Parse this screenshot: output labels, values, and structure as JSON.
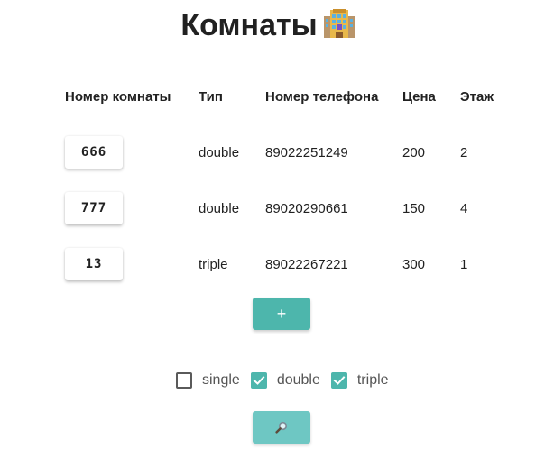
{
  "header": {
    "title": "Комнаты"
  },
  "table": {
    "columns": [
      "Номер комнаты",
      "Тип",
      "Номер телефона",
      "Цена",
      "Этаж"
    ],
    "rows": [
      {
        "room": "666",
        "type": "double",
        "phone": "89022251249",
        "price": "200",
        "floor": "2"
      },
      {
        "room": "777",
        "type": "double",
        "phone": "89020290661",
        "price": "150",
        "floor": "4"
      },
      {
        "room": "13",
        "type": "triple",
        "phone": "89022267221",
        "price": "300",
        "floor": "1"
      }
    ]
  },
  "actions": {
    "add_label": "+"
  },
  "filters": [
    {
      "label": "single",
      "checked": false
    },
    {
      "label": "double",
      "checked": true
    },
    {
      "label": "triple",
      "checked": true
    }
  ],
  "colors": {
    "accent": "#4db6ac",
    "search_button": "#6ec7c3"
  },
  "icons": {
    "title_icon": "hotel-icon",
    "search_icon": "magnifier-icon",
    "check_icon": "checkmark-icon"
  }
}
